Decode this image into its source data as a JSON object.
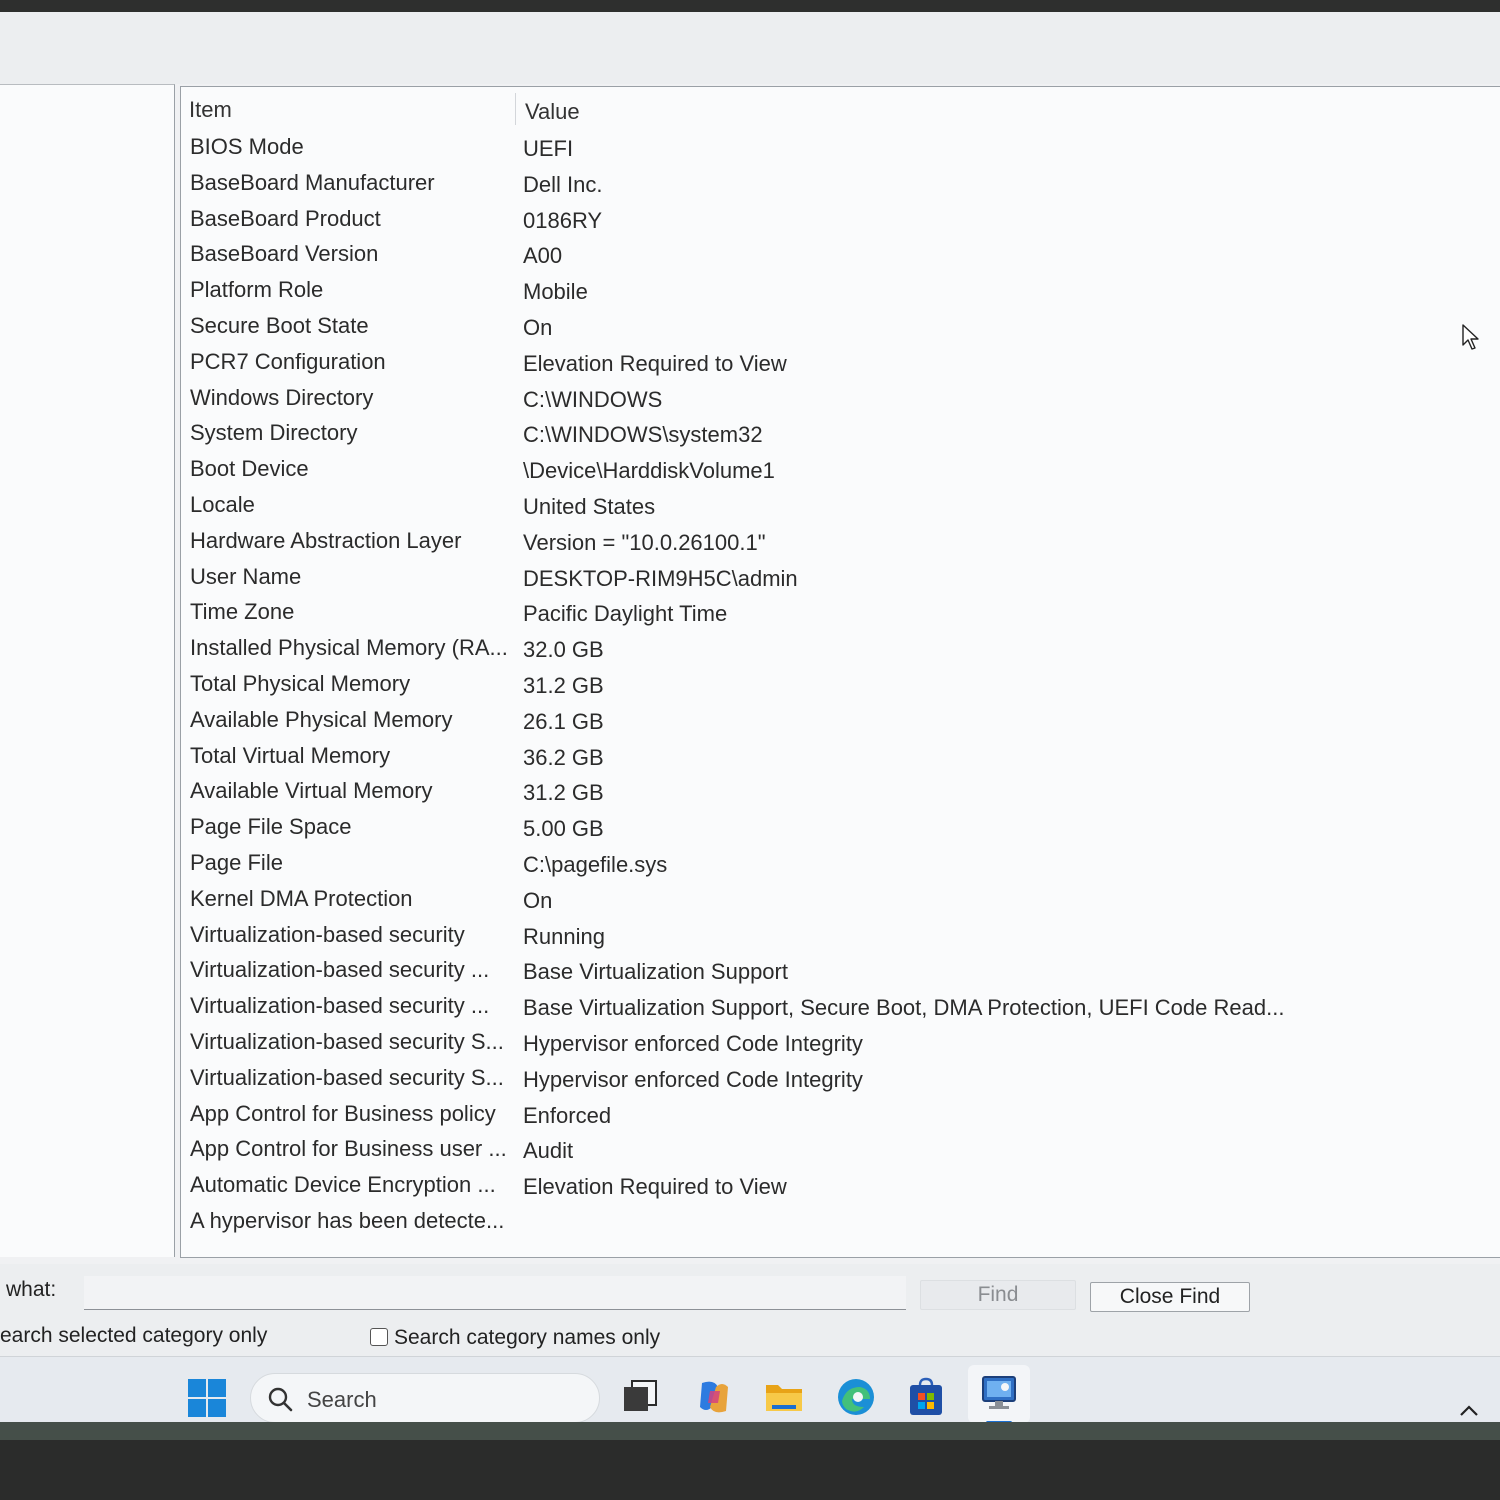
{
  "list": {
    "header": {
      "item": "Item",
      "value": "Value"
    },
    "rows": [
      {
        "item": "BIOS Mode",
        "value": "UEFI"
      },
      {
        "item": "BaseBoard Manufacturer",
        "value": "Dell Inc."
      },
      {
        "item": "BaseBoard Product",
        "value": "0186RY"
      },
      {
        "item": "BaseBoard Version",
        "value": "A00"
      },
      {
        "item": "Platform Role",
        "value": "Mobile"
      },
      {
        "item": "Secure Boot State",
        "value": "On"
      },
      {
        "item": "PCR7 Configuration",
        "value": "Elevation Required to View"
      },
      {
        "item": "Windows Directory",
        "value": "C:\\WINDOWS"
      },
      {
        "item": "System Directory",
        "value": "C:\\WINDOWS\\system32"
      },
      {
        "item": "Boot Device",
        "value": "\\Device\\HarddiskVolume1"
      },
      {
        "item": "Locale",
        "value": "United States"
      },
      {
        "item": "Hardware Abstraction Layer",
        "value": "Version = \"10.0.26100.1\""
      },
      {
        "item": "User Name",
        "value": "DESKTOP-RIM9H5C\\admin"
      },
      {
        "item": "Time Zone",
        "value": "Pacific Daylight Time"
      },
      {
        "item": "Installed Physical Memory (RA...",
        "value": "32.0 GB"
      },
      {
        "item": "Total Physical Memory",
        "value": "31.2 GB"
      },
      {
        "item": "Available Physical Memory",
        "value": "26.1 GB"
      },
      {
        "item": "Total Virtual Memory",
        "value": "36.2 GB"
      },
      {
        "item": "Available Virtual Memory",
        "value": "31.2 GB"
      },
      {
        "item": "Page File Space",
        "value": "5.00 GB"
      },
      {
        "item": "Page File",
        "value": "C:\\pagefile.sys"
      },
      {
        "item": "Kernel DMA Protection",
        "value": "On"
      },
      {
        "item": "Virtualization-based security",
        "value": "Running"
      },
      {
        "item": "Virtualization-based security ...",
        "value": "Base Virtualization Support"
      },
      {
        "item": "Virtualization-based security ...",
        "value": "Base Virtualization Support, Secure Boot, DMA Protection, UEFI Code Read..."
      },
      {
        "item": "Virtualization-based security S...",
        "value": "Hypervisor enforced Code Integrity"
      },
      {
        "item": "Virtualization-based security S...",
        "value": "Hypervisor enforced Code Integrity"
      },
      {
        "item": "App Control for Business policy",
        "value": "Enforced"
      },
      {
        "item": "App Control for Business user ...",
        "value": "Audit"
      },
      {
        "item": "Automatic Device Encryption ...",
        "value": "Elevation Required to View"
      },
      {
        "item": "A hypervisor has been detecte...",
        "value": ""
      }
    ]
  },
  "find": {
    "label": "what:",
    "input_value": "",
    "find_button": "Find",
    "close_button": "Close Find",
    "option_selected_category": "earch selected category only",
    "option_category_names": "Search category names only",
    "option_category_names_checked": false
  },
  "taskbar": {
    "search_text": "Search",
    "icons": [
      "windows-start-icon",
      "search-icon",
      "task-view-icon",
      "copilot-icon",
      "file-explorer-icon",
      "edge-icon",
      "store-icon",
      "system-information-icon",
      "chevron-up-icon"
    ],
    "accent_color": "#1a6fd1"
  }
}
